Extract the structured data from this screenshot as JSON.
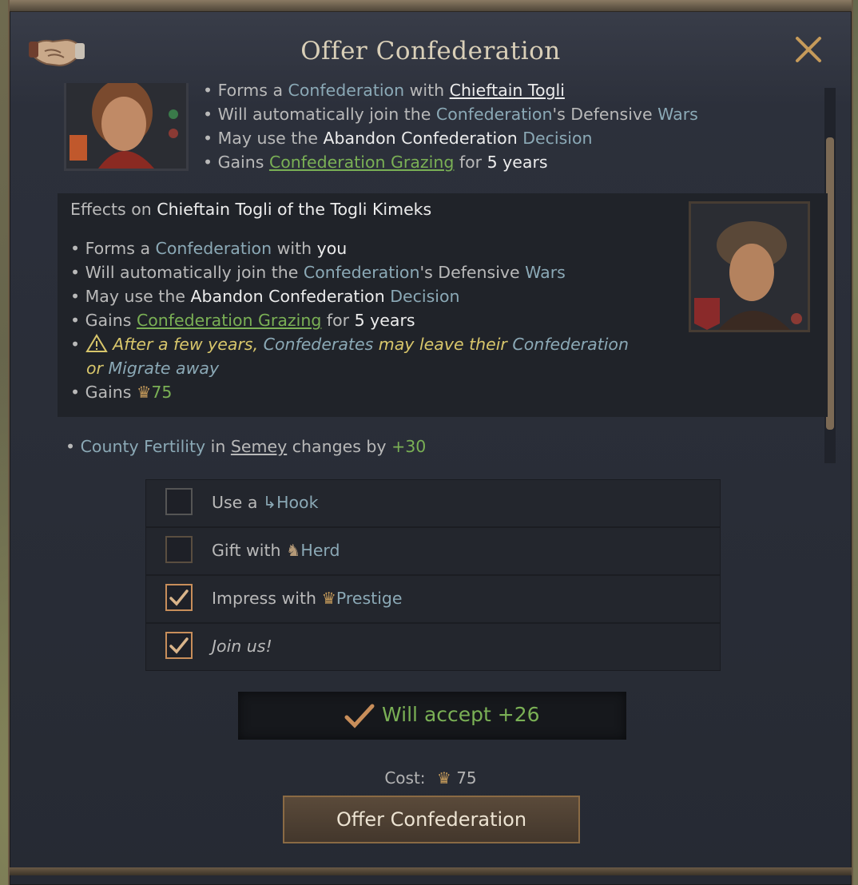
{
  "window": {
    "title": "Offer Confederation",
    "close_label": "×"
  },
  "actor_effects": {
    "lines": [
      {
        "pre": "Forms a ",
        "term": "Confederation",
        "mid": " with ",
        "target": "Chieftain Togli"
      },
      {
        "pre": "Will automatically join the ",
        "term": "Confederation",
        "mid": "'s Defensive ",
        "term2": "Wars"
      },
      {
        "pre": "May use the ",
        "strong": "Abandon Confederation",
        "term": " Decision"
      },
      {
        "pre": "Gains ",
        "link": "Confederation Grazing",
        "mid": " for ",
        "strong": "5 years"
      }
    ]
  },
  "recipient_effects": {
    "header_pre": "Effects on ",
    "header_name": "Chieftain Togli of the Togli Kimeks",
    "lines": [
      {
        "pre": "Forms a ",
        "term": "Confederation",
        "mid": " with ",
        "strong": "you"
      },
      {
        "pre": "Will automatically join the ",
        "term": "Confederation",
        "mid": "'s Defensive ",
        "term2": "Wars"
      },
      {
        "pre": "May use the ",
        "strong": "Abandon Confederation",
        "term": " Decision"
      },
      {
        "pre": "Gains ",
        "link": "Confederation Grazing",
        "mid": " for ",
        "strong": "5 years"
      }
    ],
    "warning": {
      "part1": "After a few years, ",
      "term1": "Confederates",
      "part2": " may leave their ",
      "term2": "Confederation",
      "part3": "or ",
      "term3": "Migrate away"
    },
    "gains_pre": "Gains ",
    "gains_value": "75"
  },
  "fertility": {
    "term": "County Fertility",
    "mid": " in ",
    "place": "Semey",
    "post": " changes by ",
    "value": "+30"
  },
  "options": [
    {
      "pre": "Use a ",
      "term": "Hook",
      "checked": false
    },
    {
      "pre": "Gift with ",
      "term": "Herd",
      "checked": false
    },
    {
      "pre": "Impress with ",
      "term": "Prestige",
      "checked": true
    },
    {
      "pre": "Join us!",
      "term": "",
      "checked": true
    }
  ],
  "acceptance": {
    "text": "Will accept +26"
  },
  "cost": {
    "label": "Cost:",
    "value": "75"
  },
  "offer_button": {
    "label": "Offer Confederation"
  }
}
